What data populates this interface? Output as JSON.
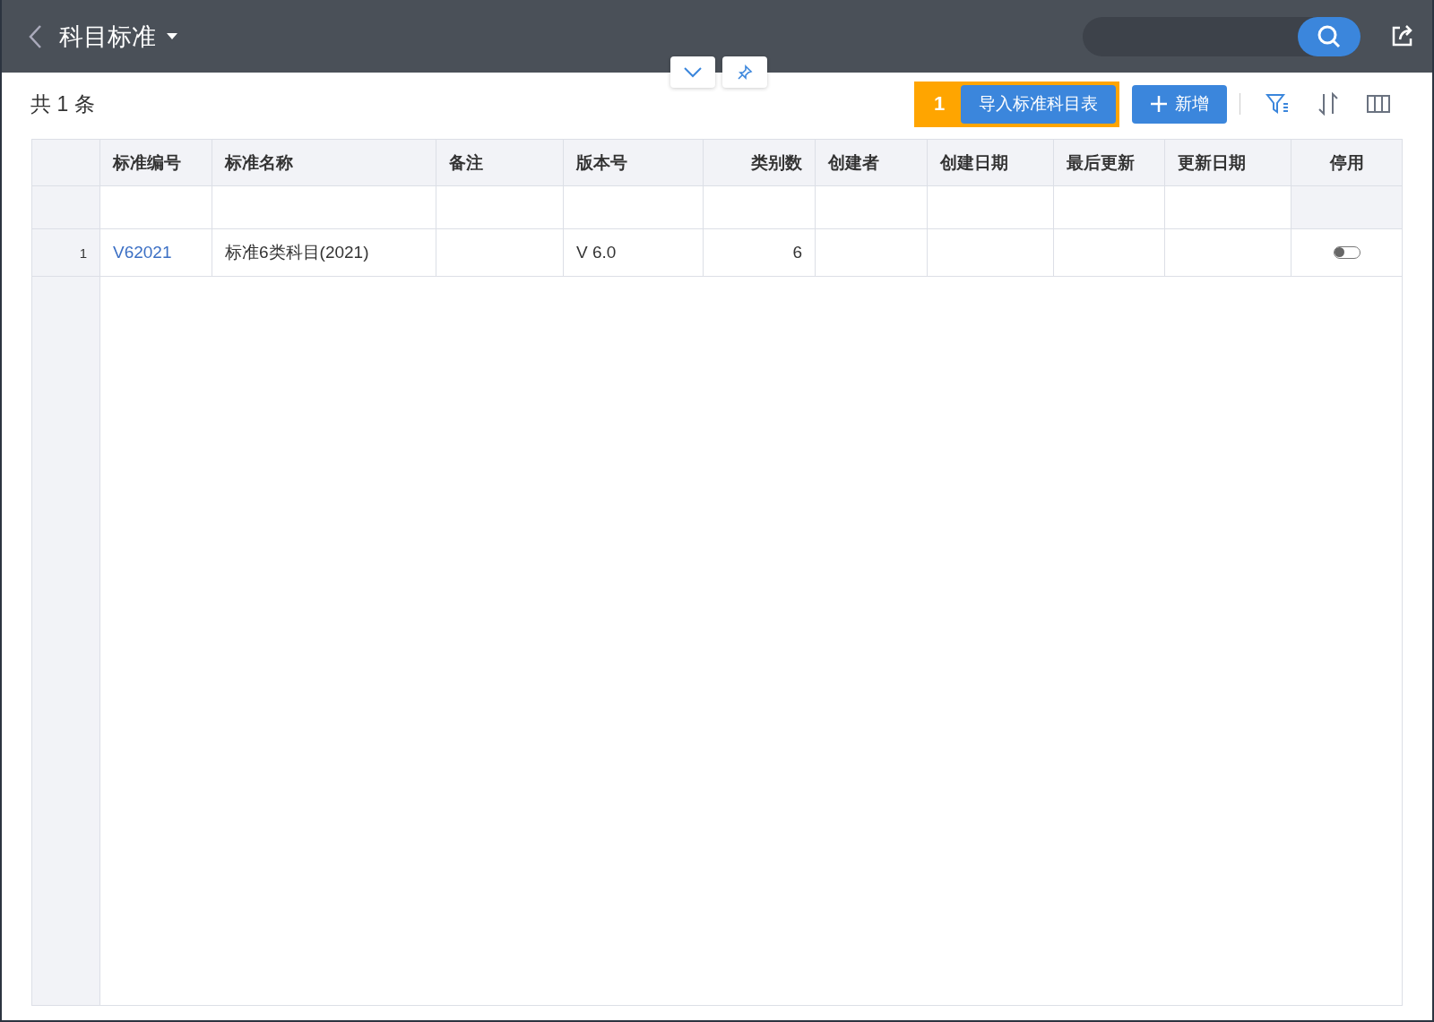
{
  "header": {
    "title": "科目标准"
  },
  "toolbar": {
    "count": "共 1 条",
    "step_marker": "1",
    "import_button": "导入标准科目表",
    "add_button": "新增"
  },
  "table": {
    "columns": [
      {},
      {
        "label": "标准编号"
      },
      {
        "label": "标准名称"
      },
      {
        "label": "备注"
      },
      {
        "label": "版本号"
      },
      {
        "label": "类别数"
      },
      {
        "label": "创建者"
      },
      {
        "label": "创建日期"
      },
      {
        "label": "最后更新"
      },
      {
        "label": "更新日期"
      },
      {
        "label": "停用"
      }
    ],
    "rows": [
      {
        "index": "1",
        "code": "V62021",
        "name": "标准6类科目(2021)",
        "version": "V 6.0",
        "categories": "6",
        "disabled": false
      }
    ]
  }
}
